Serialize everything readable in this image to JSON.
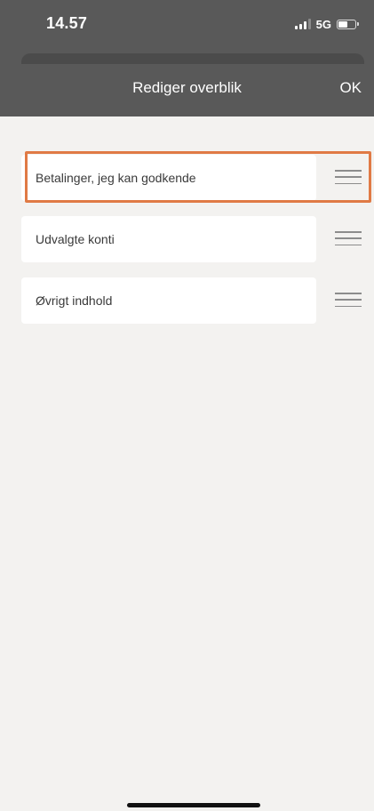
{
  "status_bar": {
    "time": "14.57",
    "network": "5G",
    "battery_level": 0.55,
    "signal_bars": 4,
    "signal_bars_active": 3
  },
  "nav": {
    "title": "Rediger overblik",
    "ok_label": "OK"
  },
  "items": [
    {
      "label": "Betalinger, jeg kan godkende",
      "highlighted": true
    },
    {
      "label": "Udvalgte konti",
      "highlighted": false
    },
    {
      "label": "Øvrigt indhold",
      "highlighted": false
    }
  ],
  "colors": {
    "header_bg": "#595959",
    "page_bg": "#f3f2f0",
    "highlight": "#e07a45"
  },
  "icons": {
    "drag": "drag-handle-icon",
    "signal": "cellular-signal-icon",
    "battery": "battery-icon"
  }
}
